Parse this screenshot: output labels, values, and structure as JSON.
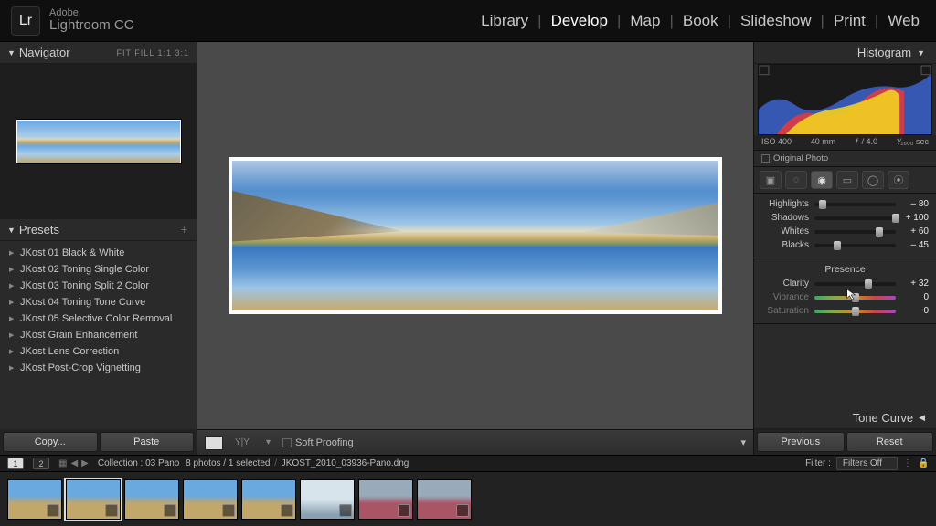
{
  "app": {
    "vendor": "Adobe",
    "product": "Lightroom CC",
    "logo_letters": "Lr"
  },
  "modules": {
    "items": [
      "Library",
      "Develop",
      "Map",
      "Book",
      "Slideshow",
      "Print",
      "Web"
    ],
    "active_index": 1
  },
  "navigator": {
    "title": "Navigator",
    "zoom_modes": "FIT   FILL   1:1   3:1"
  },
  "presets": {
    "title": "Presets",
    "items": [
      "JKost 01 Black & White",
      "JKost 02 Toning Single Color",
      "JKost 03 Toning Split 2 Color",
      "JKost 04 Toning Tone Curve",
      "JKost 05 Selective Color Removal",
      "JKost Grain Enhancement",
      "JKost Lens Correction",
      "JKost Post-Crop Vignetting"
    ],
    "copy_label": "Copy...",
    "paste_label": "Paste"
  },
  "center": {
    "soft_proofing_label": "Soft Proofing"
  },
  "histogram": {
    "title": "Histogram",
    "exif": {
      "iso": "ISO 400",
      "focal": "40 mm",
      "aperture": "ƒ / 4.0",
      "shutter": "¹⁄₁₆₀₀ sec"
    },
    "original_photo_label": "Original Photo"
  },
  "sliders": {
    "highlights": {
      "label": "Highlights",
      "value": "– 80",
      "pos": 10
    },
    "shadows": {
      "label": "Shadows",
      "value": "+ 100",
      "pos": 100
    },
    "whites": {
      "label": "Whites",
      "value": "+ 60",
      "pos": 80
    },
    "blacks": {
      "label": "Blacks",
      "value": "– 45",
      "pos": 28
    },
    "presence_title": "Presence",
    "clarity": {
      "label": "Clarity",
      "value": "+ 32",
      "pos": 66
    },
    "vibrance": {
      "label": "Vibrance",
      "value": "0",
      "pos": 50
    },
    "saturation": {
      "label": "Saturation",
      "value": "0",
      "pos": 50
    }
  },
  "tone_curve": {
    "title": "Tone Curve"
  },
  "right_buttons": {
    "previous": "Previous",
    "reset": "Reset"
  },
  "filmstrip": {
    "pages": [
      "1",
      "2"
    ],
    "active_page_index": 0,
    "collection_label": "Collection :",
    "collection_name": "03 Pano",
    "count_text": "8 photos / 1 selected",
    "filename": "JKOST_2010_03936-Pano.dng",
    "filter_label": "Filter :",
    "filter_value": "Filters Off"
  }
}
